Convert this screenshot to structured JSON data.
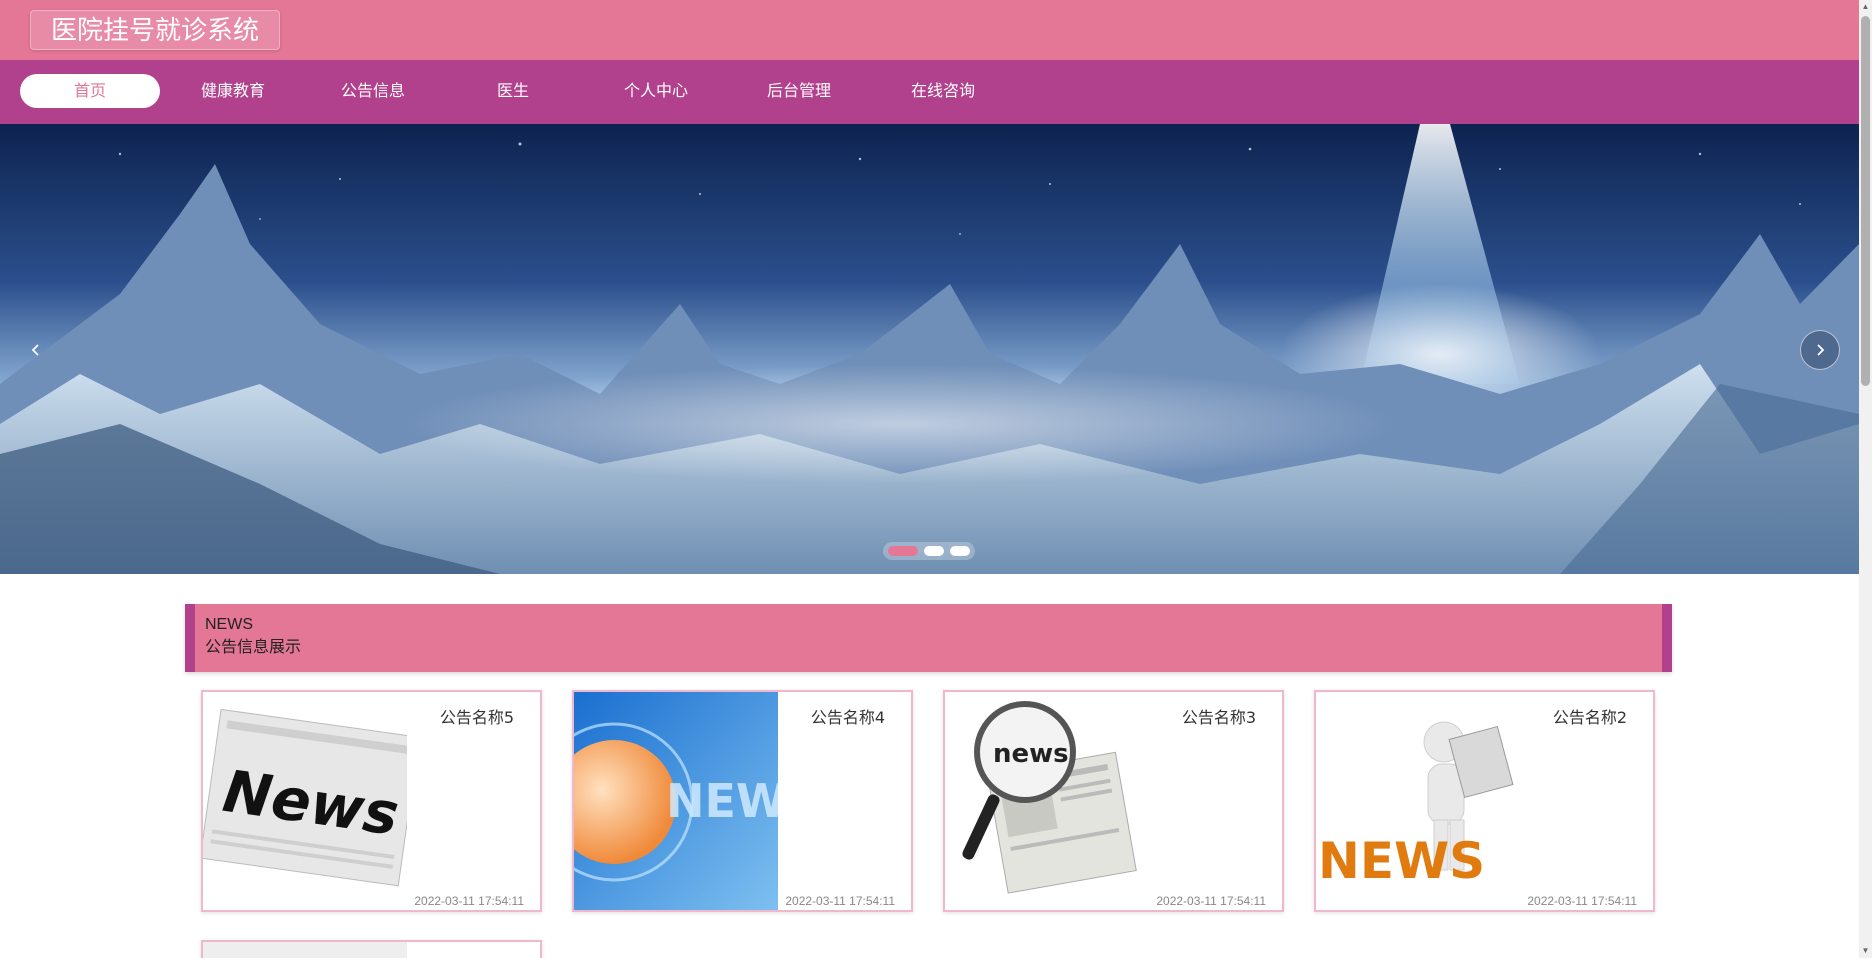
{
  "header": {
    "title": "医院挂号就诊系统"
  },
  "nav": {
    "items": [
      {
        "label": "首页",
        "active": true
      },
      {
        "label": "健康教育"
      },
      {
        "label": "公告信息"
      },
      {
        "label": "医生"
      },
      {
        "label": "个人中心"
      },
      {
        "label": "后台管理"
      },
      {
        "label": "在线咨询"
      }
    ]
  },
  "banner": {
    "image": "icy-mountain-landscape",
    "prev_icon": "chevron-left-icon",
    "next_icon": "chevron-right-icon",
    "dots": 3,
    "active_dot": 0
  },
  "news": {
    "en_title": "NEWS",
    "cn_title": "公告信息展示",
    "cards": [
      {
        "title": "公告名称5",
        "time": "2022-03-11 17:54:11",
        "thumb": "newspaper-news"
      },
      {
        "title": "公告名称4",
        "time": "2022-03-11 17:54:11",
        "thumb": "globe-news"
      },
      {
        "title": "公告名称3",
        "time": "2022-03-11 17:54:11",
        "thumb": "magnifier-news"
      },
      {
        "title": "公告名称2",
        "time": "2022-03-11 17:54:11",
        "thumb": "figure-news"
      }
    ]
  },
  "colors": {
    "primary": "#e47696",
    "nav": "#b1418c",
    "card_border": "#f0b8cf"
  }
}
